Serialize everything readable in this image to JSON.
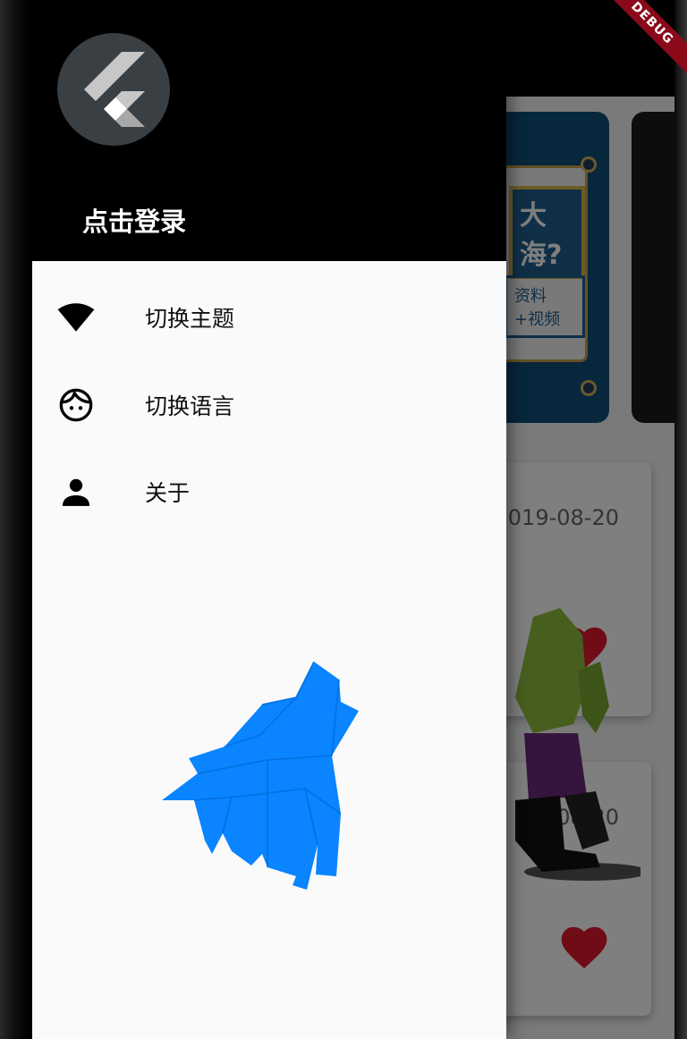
{
  "debug_banner": {
    "label": "DEBUG"
  },
  "drawer": {
    "login_label": "点击登录",
    "menu_items": [
      {
        "icon": "wifi-icon",
        "label": "切换主题"
      },
      {
        "icon": "face-icon",
        "label": "切换语言"
      },
      {
        "icon": "person-icon",
        "label": "关于"
      }
    ],
    "accent_color": "#0a84ff"
  },
  "background": {
    "banner_title": "大海?",
    "banner_subtitle": "资料+视频",
    "cards": [
      {
        "date": "2019-08-20"
      },
      {
        "date": "08-20"
      }
    ]
  }
}
